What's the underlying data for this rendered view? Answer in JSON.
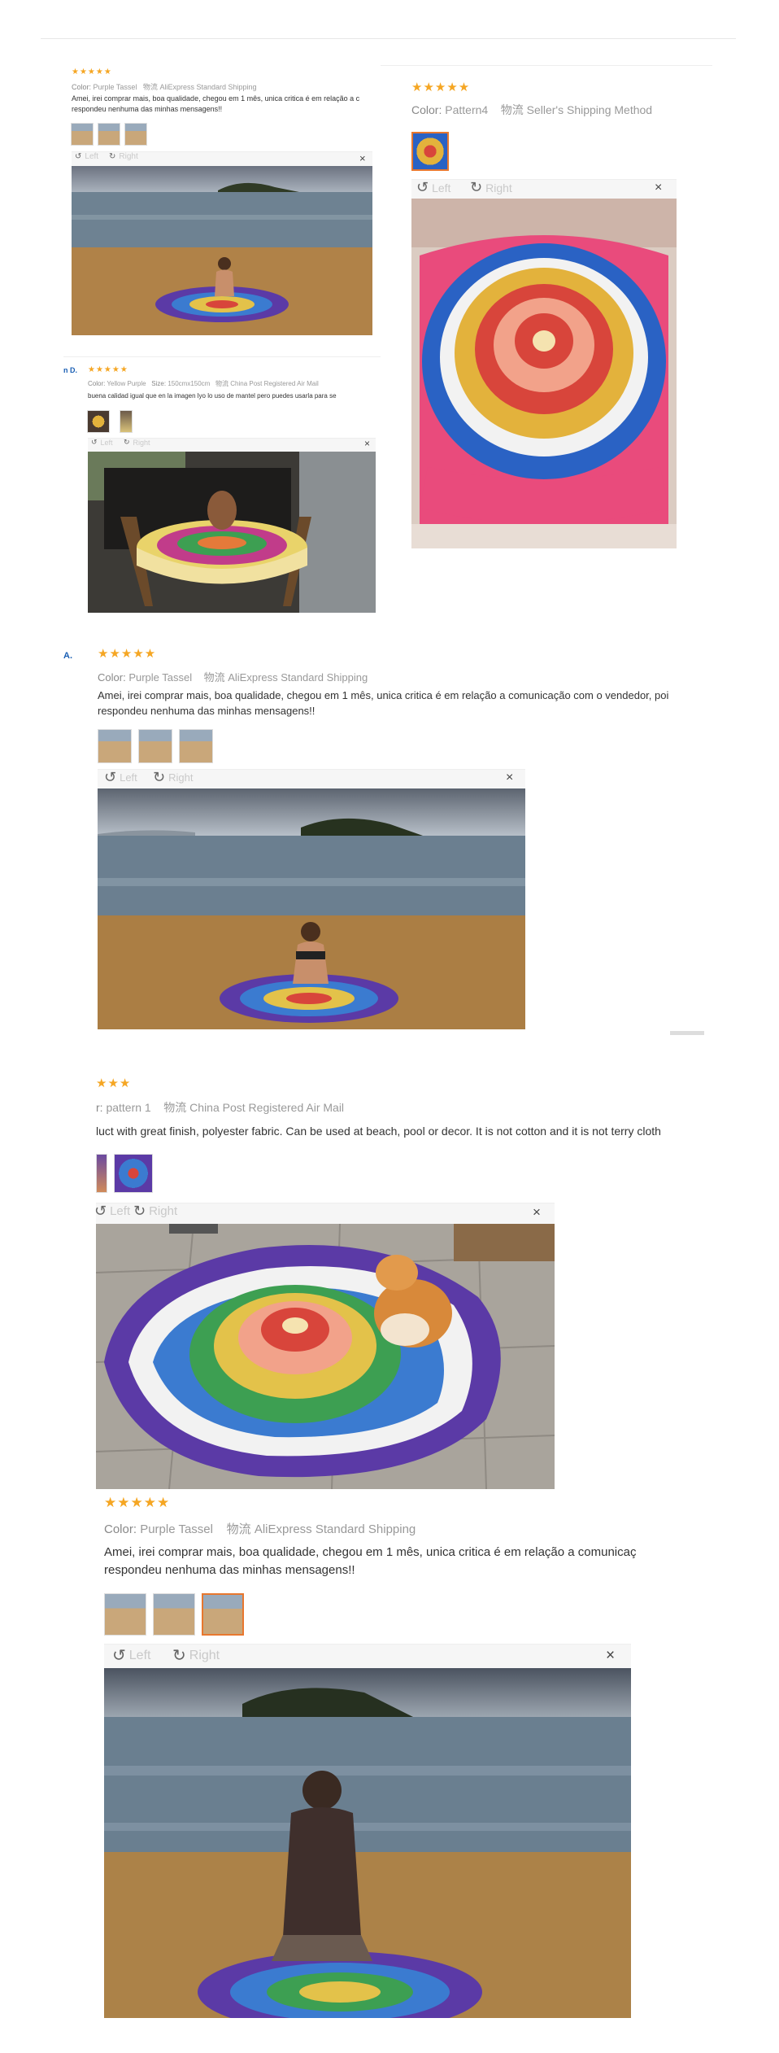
{
  "stars_text": "★★★★★",
  "partial_stars_text": "★★★",
  "reviews": [
    {
      "color_label": "Color:",
      "color_value": "Purple Tassel",
      "ship_icon": "物流",
      "shipping": "AliExpress Standard Shipping",
      "text_line1": "Amei, irei comprar mais, boa qualidade, chegou em 1 mês, unica critica é em relação a c",
      "text_line2": "respondeu nenhuma das minhas mensagens!!"
    },
    {
      "color_label": "Color:",
      "color_value": "Pattern4",
      "ship_icon": "物流",
      "shipping": "Seller's Shipping Method"
    },
    {
      "name": "n D.",
      "color_label": "Color:",
      "color_value": "Yellow Purple",
      "size_label": "Size:",
      "size_value": "150cmx150cm",
      "ship_icon": "物流",
      "shipping": "China Post Registered Air Mail",
      "text_line1": "buena calidad igual que en la imagen lyo lo uso de mantel pero puedes usarla para se"
    },
    {
      "name": "A.",
      "color_label": "Color:",
      "color_value": "Purple Tassel",
      "ship_icon": "物流",
      "shipping": "AliExpress Standard Shipping",
      "text_line1": "Amei, irei comprar mais, boa qualidade, chegou em 1 mês, unica critica é em relação a comunicação com o vendedor, poi",
      "text_line2": "respondeu nenhuma das minhas mensagens!!"
    },
    {
      "color_label": "r:",
      "color_value": "pattern 1",
      "ship_icon": "物流",
      "shipping": "China Post Registered Air Mail",
      "text_line1": "luct with great finish, polyester fabric. Can be used at beach, pool or decor. It is not cotton and it is not terry cloth"
    },
    {
      "color_label": "Color:",
      "color_value": "Purple Tassel",
      "ship_icon": "物流",
      "shipping": "AliExpress Standard Shipping",
      "text_line1": "Amei, irei comprar mais, boa qualidade, chegou em 1 mês, unica critica é em relação a comunicaç",
      "text_line2": "respondeu nenhuma das minhas mensagens!!"
    }
  ],
  "viewer": {
    "rotate_left": "Left",
    "rotate_right": "Right",
    "close": "×",
    "left_icon": "rotate-left-icon",
    "right_icon": "rotate-right-icon"
  },
  "colors": {
    "stars": "#f5a623",
    "selected_thumb": "#e8772e",
    "name": "#1a5fb4"
  }
}
